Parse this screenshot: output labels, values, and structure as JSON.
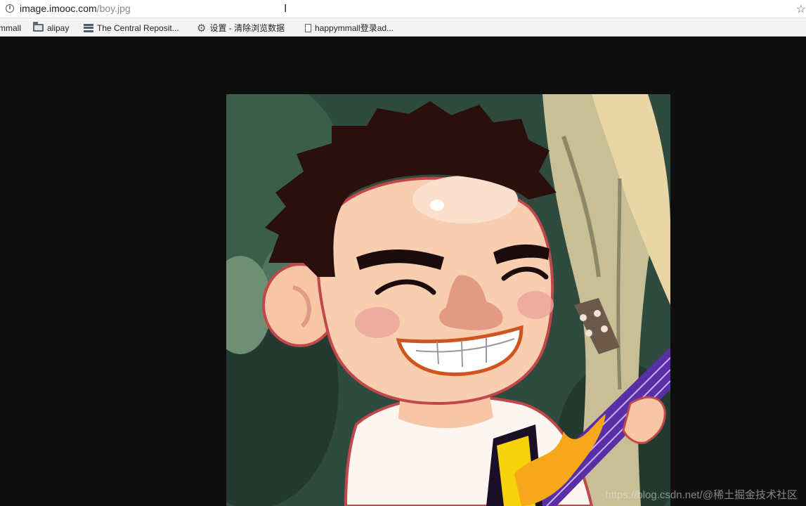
{
  "browser": {
    "url_host": "image.imooc.com",
    "url_path": "/boy.jpg",
    "info_icon": "info-icon",
    "star_icon": "bookmark-star-icon"
  },
  "bookmarks": [
    {
      "label": "mmall",
      "icon": "folder-icon"
    },
    {
      "label": "alipay",
      "icon": "folder-icon"
    },
    {
      "label": "The Central Reposit...",
      "icon": "stack-icon"
    },
    {
      "label": "设置 - 清除浏览数据",
      "icon": "gear-icon"
    },
    {
      "label": "happymmall登录ad...",
      "icon": "page-icon"
    }
  ],
  "image": {
    "alt": "boy.jpg",
    "description_icon": "cartoon-boy-guitar-image"
  },
  "watermark": "https://blog.csdn.net/@稀土掘金技术社区",
  "colors": {
    "background": "#0e0e0e",
    "foliage": "#2f4a3e",
    "guitar": "#5a2ea6"
  }
}
